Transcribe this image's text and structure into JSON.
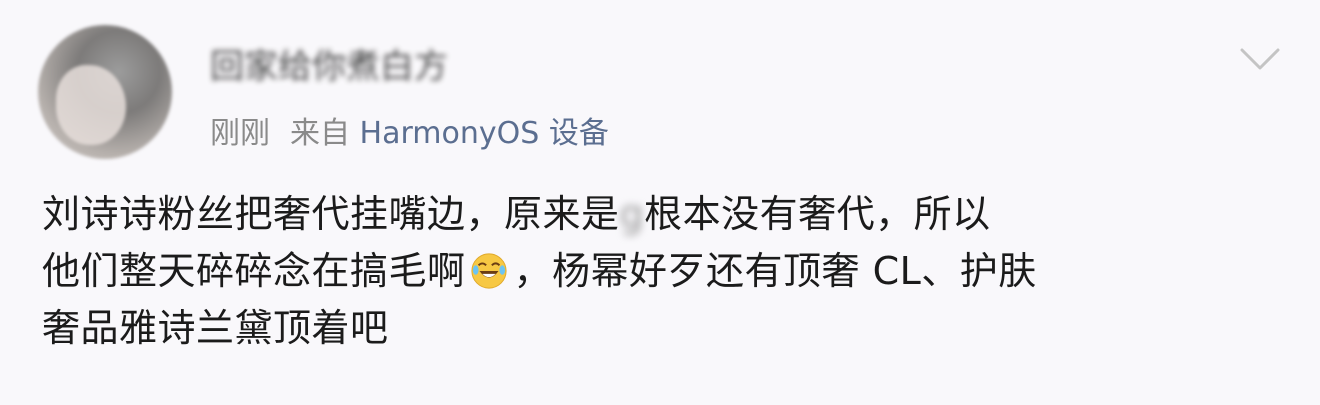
{
  "post": {
    "username": "回家给你煮白方",
    "time": "刚刚",
    "source_prefix": "来自",
    "source_device": "HarmonyOS 设备",
    "lines": [
      [
        "刘诗诗粉丝把奢代挂嘴边，原来是",
        "g",
        "根本没有奢代，所以"
      ],
      [
        "他们整天碎碎念在搞毛啊",
        "，杨幂好歹还有顶奢 CL、护肤"
      ],
      [
        "奢品雅诗兰黛顶着吧"
      ]
    ],
    "emoji": "laughing-crying-emoji",
    "icons": {
      "expand": "chevron-down-icon"
    }
  }
}
